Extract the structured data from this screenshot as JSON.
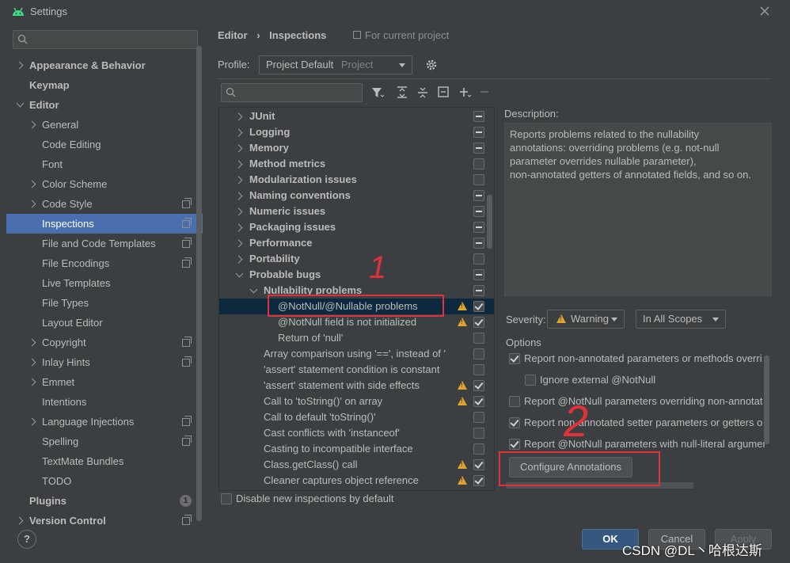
{
  "window": {
    "title": "Settings"
  },
  "sidebar": {
    "search_placeholder": "",
    "items": [
      {
        "label": "Appearance & Behavior",
        "bold": true,
        "chev": "right",
        "level": 0
      },
      {
        "label": "Keymap",
        "bold": true,
        "chev": "",
        "level": 0
      },
      {
        "label": "Editor",
        "bold": true,
        "chev": "down",
        "level": 0
      },
      {
        "label": "General",
        "chev": "right",
        "level": 1
      },
      {
        "label": "Code Editing",
        "chev": "",
        "level": 1
      },
      {
        "label": "Font",
        "chev": "",
        "level": 1
      },
      {
        "label": "Color Scheme",
        "chev": "right",
        "level": 1
      },
      {
        "label": "Code Style",
        "chev": "right",
        "level": 1,
        "project": true
      },
      {
        "label": "Inspections",
        "chev": "",
        "level": 1,
        "project": true,
        "selected": true
      },
      {
        "label": "File and Code Templates",
        "chev": "",
        "level": 1,
        "project": true
      },
      {
        "label": "File Encodings",
        "chev": "",
        "level": 1,
        "project": true
      },
      {
        "label": "Live Templates",
        "chev": "",
        "level": 1
      },
      {
        "label": "File Types",
        "chev": "",
        "level": 1
      },
      {
        "label": "Layout Editor",
        "chev": "",
        "level": 1
      },
      {
        "label": "Copyright",
        "chev": "right",
        "level": 1,
        "project": true
      },
      {
        "label": "Inlay Hints",
        "chev": "right",
        "level": 1,
        "project": true
      },
      {
        "label": "Emmet",
        "chev": "right",
        "level": 1
      },
      {
        "label": "Intentions",
        "chev": "",
        "level": 1
      },
      {
        "label": "Language Injections",
        "chev": "right",
        "level": 1,
        "project": true
      },
      {
        "label": "Spelling",
        "chev": "",
        "level": 1,
        "project": true
      },
      {
        "label": "TextMate Bundles",
        "chev": "",
        "level": 1
      },
      {
        "label": "TODO",
        "chev": "",
        "level": 1
      },
      {
        "label": "Plugins",
        "bold": true,
        "chev": "",
        "level": 0,
        "badge": "1"
      },
      {
        "label": "Version Control",
        "bold": true,
        "chev": "right",
        "level": 0,
        "project": true
      }
    ]
  },
  "breadcrumb": {
    "part1": "Editor",
    "part2": "Inspections",
    "scope_note": "For current project"
  },
  "profile": {
    "label": "Profile:",
    "value": "Project Default",
    "suffix": "Project"
  },
  "tree": {
    "rows": [
      {
        "label": "JUnit",
        "level": 0,
        "bold": true,
        "chev": "right",
        "cb": "mixed"
      },
      {
        "label": "Logging",
        "level": 0,
        "bold": true,
        "chev": "right",
        "cb": "mixed"
      },
      {
        "label": "Memory",
        "level": 0,
        "bold": true,
        "chev": "right",
        "cb": "mixed"
      },
      {
        "label": "Method metrics",
        "level": 0,
        "bold": true,
        "chev": "right",
        "cb": "empty"
      },
      {
        "label": "Modularization issues",
        "level": 0,
        "bold": true,
        "chev": "right",
        "cb": "empty"
      },
      {
        "label": "Naming conventions",
        "level": 0,
        "bold": true,
        "chev": "right",
        "cb": "mixed"
      },
      {
        "label": "Numeric issues",
        "level": 0,
        "bold": true,
        "chev": "right",
        "cb": "mixed"
      },
      {
        "label": "Packaging issues",
        "level": 0,
        "bold": true,
        "chev": "right",
        "cb": "mixed"
      },
      {
        "label": "Performance",
        "level": 0,
        "bold": true,
        "chev": "right",
        "cb": "mixed"
      },
      {
        "label": "Portability",
        "level": 0,
        "bold": true,
        "chev": "right",
        "cb": "empty"
      },
      {
        "label": "Probable bugs",
        "level": 0,
        "bold": true,
        "chev": "down",
        "cb": "mixed"
      },
      {
        "label": "Nullability problems",
        "level": 1,
        "bold": true,
        "chev": "down",
        "cb": "mixed"
      },
      {
        "label": "@NotNull/@Nullable problems",
        "level": 2,
        "selected": true,
        "warn": true,
        "cb": "checked"
      },
      {
        "label": "@NotNull field is not initialized",
        "level": 2,
        "warn": true,
        "cb": "checked"
      },
      {
        "label": "Return of 'null'",
        "level": 2,
        "cb": "empty"
      },
      {
        "label": "Array comparison using '==', instead of '",
        "level": 1,
        "cb": "empty"
      },
      {
        "label": "'assert' statement condition is constant",
        "level": 1,
        "cb": "empty"
      },
      {
        "label": "'assert' statement with side effects",
        "level": 1,
        "warn": true,
        "cb": "checked"
      },
      {
        "label": "Call to 'toString()' on array",
        "level": 1,
        "warn": true,
        "cb": "checked"
      },
      {
        "label": "Call to default 'toString()'",
        "level": 1,
        "cb": "empty"
      },
      {
        "label": "Cast conflicts with 'instanceof'",
        "level": 1,
        "cb": "empty"
      },
      {
        "label": "Casting to incompatible interface",
        "level": 1,
        "cb": "empty"
      },
      {
        "label": "Class.getClass() call",
        "level": 1,
        "warn": true,
        "cb": "checked"
      },
      {
        "label": "Cleaner captures object reference",
        "level": 1,
        "warn": true,
        "cb": "checked"
      }
    ]
  },
  "disable_new": "Disable new inspections by default",
  "description": {
    "label": "Description:",
    "line1": "Reports problems related to the nullability",
    "line2": "annotations: overriding problems (e.g. not-null",
    "line3": "parameter overrides nullable parameter),",
    "line4": "non-annotated getters of annotated fields, and so on."
  },
  "severity": {
    "label": "Severity:",
    "value": "Warning",
    "scope": "In All Scopes"
  },
  "options": {
    "label": "Options",
    "items": [
      {
        "text": "Report non-annotated parameters or methods overri",
        "checked": true,
        "indent": 0
      },
      {
        "text": "Ignore external @NotNull",
        "checked": false,
        "indent": 1
      },
      {
        "text": "Report @NotNull parameters overriding non-annotat",
        "checked": false,
        "indent": 0
      },
      {
        "text": "Report non-annotated setter parameters or getters o",
        "checked": true,
        "indent": 0
      },
      {
        "text": "Report @NotNull parameters with null-literal argumer",
        "checked": true,
        "indent": 0
      }
    ],
    "configure_button": "Configure Annotations"
  },
  "footer": {
    "ok": "OK",
    "cancel": "Cancel",
    "apply": "Apply",
    "help": "?"
  },
  "annotations": {
    "mark1": "1",
    "mark2": "2"
  },
  "watermark": "CSDN @DL丶哈根达斯",
  "colors": {
    "accent": "#4b6eaf",
    "annotation": "#e0323a",
    "warning": "#e0a52a"
  }
}
